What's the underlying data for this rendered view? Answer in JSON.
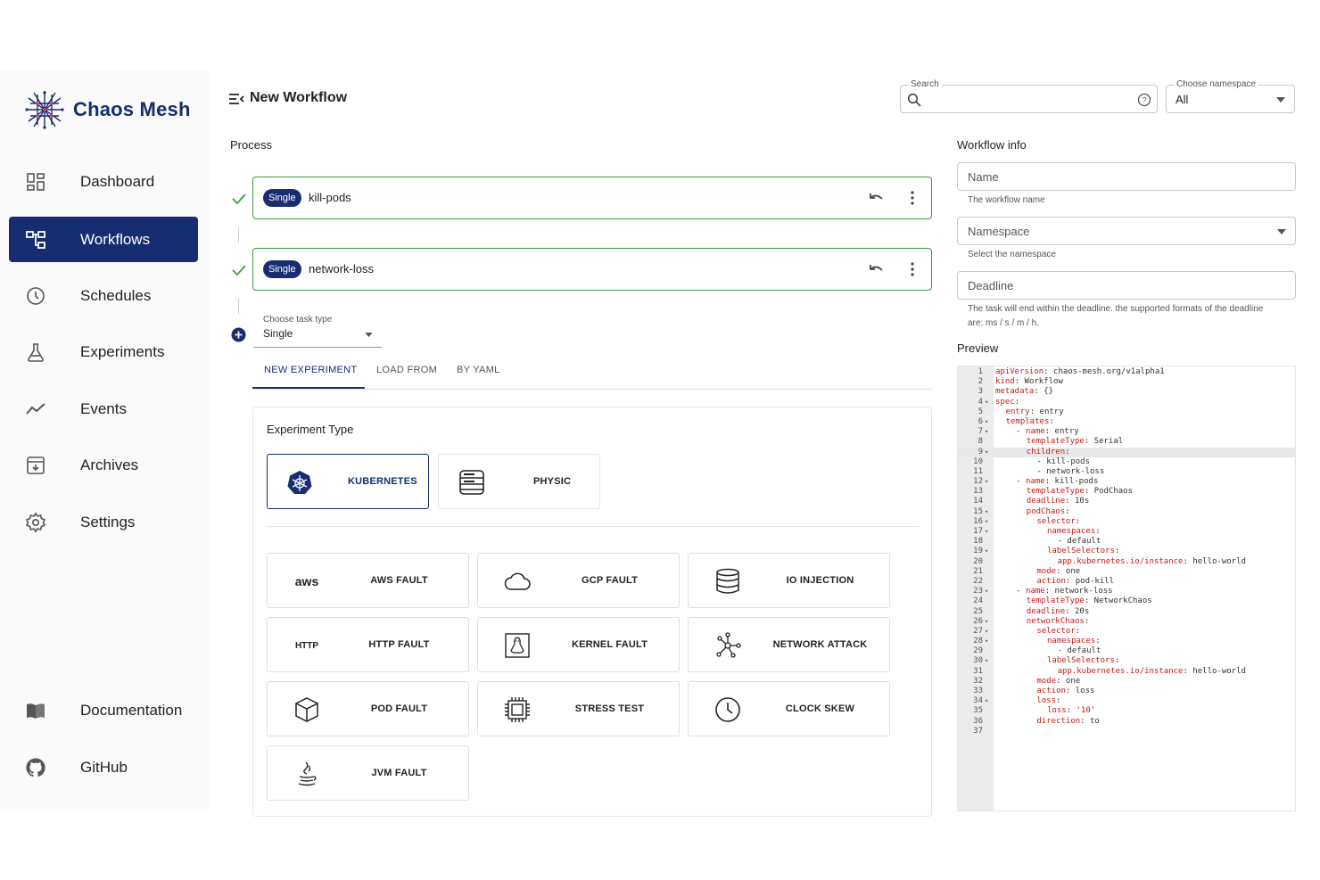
{
  "app": {
    "name": "Chaos Mesh"
  },
  "sidebar": {
    "items": [
      {
        "label": "Dashboard",
        "icon": "dashboard-icon"
      },
      {
        "label": "Workflows",
        "icon": "workflow-icon",
        "active": true
      },
      {
        "label": "Schedules",
        "icon": "clock-icon"
      },
      {
        "label": "Experiments",
        "icon": "flask-icon"
      },
      {
        "label": "Events",
        "icon": "trend-line-icon"
      },
      {
        "label": "Archives",
        "icon": "archive-icon"
      },
      {
        "label": "Settings",
        "icon": "gear-icon"
      }
    ],
    "bottom": [
      {
        "label": "Documentation",
        "icon": "book-icon"
      },
      {
        "label": "GitHub",
        "icon": "github-icon"
      }
    ]
  },
  "header": {
    "title": "New Workflow",
    "search_label": "Search",
    "namespace_label": "Choose namespace",
    "namespace_value": "All"
  },
  "process": {
    "title": "Process",
    "tasks": [
      {
        "badge": "Single",
        "name": "kill-pods"
      },
      {
        "badge": "Single",
        "name": "network-loss"
      }
    ],
    "task_type_label": "Choose task type",
    "task_type_value": "Single",
    "tabs": [
      "NEW EXPERIMENT",
      "LOAD FROM",
      "BY YAML"
    ]
  },
  "experiment": {
    "title": "Experiment Type",
    "types": [
      {
        "label": "KUBERNETES",
        "icon": "kubernetes-icon",
        "active": true
      },
      {
        "label": "PHYSIC",
        "icon": "server-icon"
      }
    ],
    "faults": [
      {
        "label": "AWS FAULT",
        "icon": "aws-icon",
        "icon_text": "aws"
      },
      {
        "label": "GCP FAULT",
        "icon": "cloud-icon"
      },
      {
        "label": "IO INJECTION",
        "icon": "database-icon"
      },
      {
        "label": "HTTP FAULT",
        "icon": "http-icon",
        "icon_text": "HTTP"
      },
      {
        "label": "KERNEL FAULT",
        "icon": "linux-icon"
      },
      {
        "label": "NETWORK ATTACK",
        "icon": "network-icon"
      },
      {
        "label": "POD FAULT",
        "icon": "cube-icon"
      },
      {
        "label": "STRESS TEST",
        "icon": "chip-icon"
      },
      {
        "label": "CLOCK SKEW",
        "icon": "clock-icon"
      },
      {
        "label": "JVM FAULT",
        "icon": "java-icon"
      }
    ]
  },
  "workflow_info": {
    "title": "Workflow info",
    "name_placeholder": "Name",
    "name_helper": "The workflow name",
    "namespace_placeholder": "Namespace",
    "namespace_helper": "Select the namespace",
    "deadline_placeholder": "Deadline",
    "deadline_helper_1": "The task will end within the deadline. the supported formats of the deadline",
    "deadline_helper_2": "are: ms / s / m / h."
  },
  "preview": {
    "title": "Preview",
    "highlight_line": 9,
    "lines": [
      {
        "n": "1",
        "f": "",
        "k": "apiVersion",
        "v": " chaos-mesh.org/v1alpha1",
        "i": 0
      },
      {
        "n": "2",
        "f": "",
        "k": "kind",
        "v": " Workflow",
        "i": 0
      },
      {
        "n": "3",
        "f": "",
        "k": "metadata",
        "v": " {}",
        "i": 0
      },
      {
        "n": "4",
        "f": "▾",
        "k": "spec",
        "v": "",
        "i": 0
      },
      {
        "n": "5",
        "f": "",
        "k": "entry",
        "v": " entry",
        "i": 1
      },
      {
        "n": "6",
        "f": "▾",
        "k": "templates",
        "v": "",
        "i": 1
      },
      {
        "n": "7",
        "f": "▾",
        "p": "- ",
        "k": "name",
        "v": " entry",
        "i": 2
      },
      {
        "n": "8",
        "f": "",
        "k": "templateType",
        "v": " Serial",
        "i": 3
      },
      {
        "n": "9",
        "f": "▾",
        "k": "children",
        "v": "",
        "i": 3
      },
      {
        "n": "10",
        "f": "",
        "t": "- kill-pods",
        "i": 4
      },
      {
        "n": "11",
        "f": "",
        "t": "- network-loss",
        "i": 4
      },
      {
        "n": "12",
        "f": "▾",
        "p": "- ",
        "k": "name",
        "v": " kill-pods",
        "i": 2
      },
      {
        "n": "13",
        "f": "",
        "k": "templateType",
        "v": " PodChaos",
        "i": 3
      },
      {
        "n": "14",
        "f": "",
        "k": "deadline",
        "v": " 10s",
        "i": 3
      },
      {
        "n": "15",
        "f": "▾",
        "k": "podChaos",
        "v": "",
        "i": 3
      },
      {
        "n": "16",
        "f": "▾",
        "k": "selector",
        "v": "",
        "i": 4
      },
      {
        "n": "17",
        "f": "▾",
        "k": "namespaces",
        "v": "",
        "i": 5
      },
      {
        "n": "18",
        "f": "",
        "t": "- default",
        "i": 6
      },
      {
        "n": "19",
        "f": "▾",
        "k": "labelSelectors",
        "v": "",
        "i": 5
      },
      {
        "n": "20",
        "f": "",
        "k": "app.kubernetes.io/instance",
        "v": " hello-world",
        "i": 6
      },
      {
        "n": "21",
        "f": "",
        "k": "mode",
        "v": " one",
        "i": 4
      },
      {
        "n": "22",
        "f": "",
        "k": "action",
        "v": " pod-kill",
        "i": 4
      },
      {
        "n": "23",
        "f": "▾",
        "p": "- ",
        "k": "name",
        "v": " network-loss",
        "i": 2
      },
      {
        "n": "24",
        "f": "",
        "k": "templateType",
        "v": " NetworkChaos",
        "i": 3
      },
      {
        "n": "25",
        "f": "",
        "k": "deadline",
        "v": " 20s",
        "i": 3
      },
      {
        "n": "26",
        "f": "▾",
        "k": "networkChaos",
        "v": "",
        "i": 3
      },
      {
        "n": "27",
        "f": "▾",
        "k": "selector",
        "v": "",
        "i": 4
      },
      {
        "n": "28",
        "f": "▾",
        "k": "namespaces",
        "v": "",
        "i": 5
      },
      {
        "n": "29",
        "f": "",
        "t": "- default",
        "i": 6
      },
      {
        "n": "30",
        "f": "▾",
        "k": "labelSelectors",
        "v": "",
        "i": 5
      },
      {
        "n": "31",
        "f": "",
        "k": "app.kubernetes.io/instance",
        "v": " hello-world",
        "i": 6
      },
      {
        "n": "32",
        "f": "",
        "k": "mode",
        "v": " one",
        "i": 4
      },
      {
        "n": "33",
        "f": "",
        "k": "action",
        "v": " loss",
        "i": 4
      },
      {
        "n": "34",
        "f": "▾",
        "k": "loss",
        "v": "",
        "i": 4
      },
      {
        "n": "35",
        "f": "",
        "k": "loss",
        "v": " '10'",
        "i": 5,
        "vs": true
      },
      {
        "n": "36",
        "f": "",
        "k": "direction",
        "v": " to",
        "i": 4
      },
      {
        "n": "37",
        "f": "",
        "t": "",
        "i": 0
      }
    ]
  },
  "colors": {
    "primary": "#172d72",
    "success": "#3d9b3d",
    "yaml_key": "#c41a16"
  }
}
